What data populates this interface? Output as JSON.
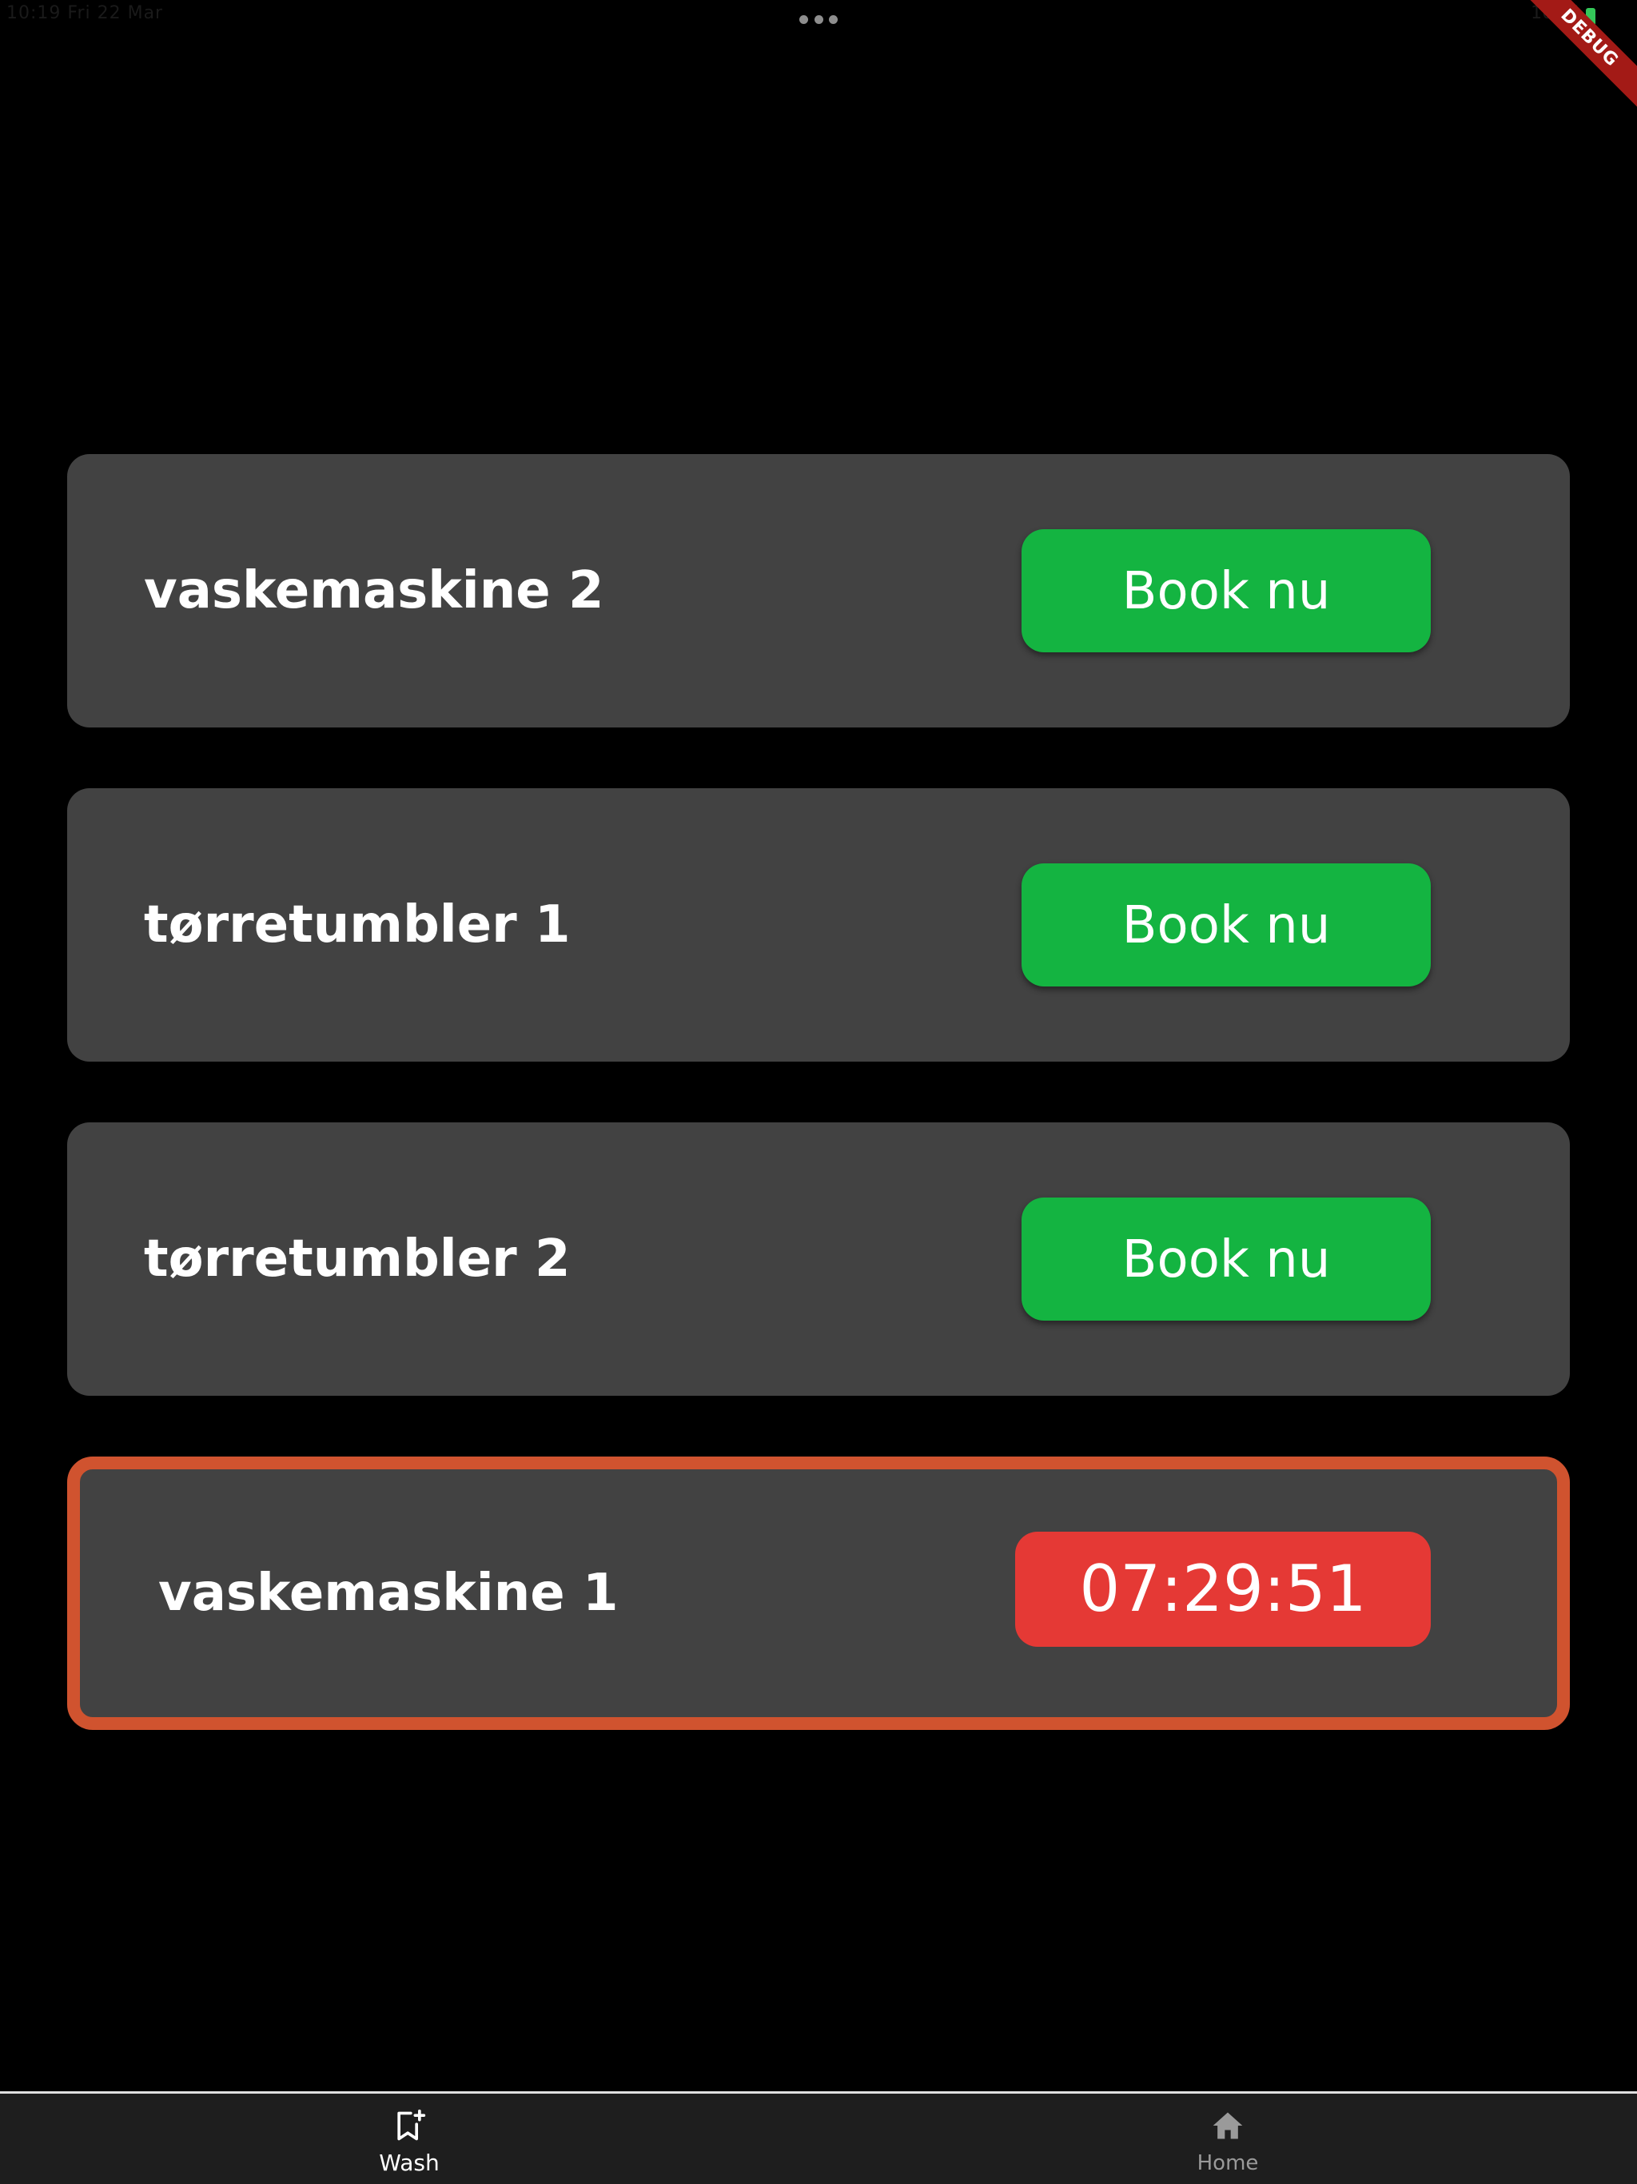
{
  "status_bar": {
    "time": "10:19 Fri 22 Mar",
    "indicators": "100%"
  },
  "debug_banner": {
    "label": "DEBUG"
  },
  "machines": [
    {
      "name": "vaskemaskine 2",
      "action_label": "Book nu"
    },
    {
      "name": "tørretumbler 1",
      "action_label": "Book nu"
    },
    {
      "name": "tørretumbler 2",
      "action_label": "Book nu"
    }
  ],
  "active_booking": {
    "name": "vaskemaskine 1",
    "countdown": "07:29:51"
  },
  "colors": {
    "background": "#000000",
    "card": "#424242",
    "book_button": "#14b441",
    "active_border": "#d0532f",
    "timer_badge": "#e53935",
    "nav_background": "#1e1e1e"
  },
  "bottom_nav": {
    "items": [
      {
        "label": "Wash",
        "icon": "bookmark-add-icon",
        "selected": true
      },
      {
        "label": "Home",
        "icon": "home-icon",
        "selected": false
      }
    ]
  }
}
